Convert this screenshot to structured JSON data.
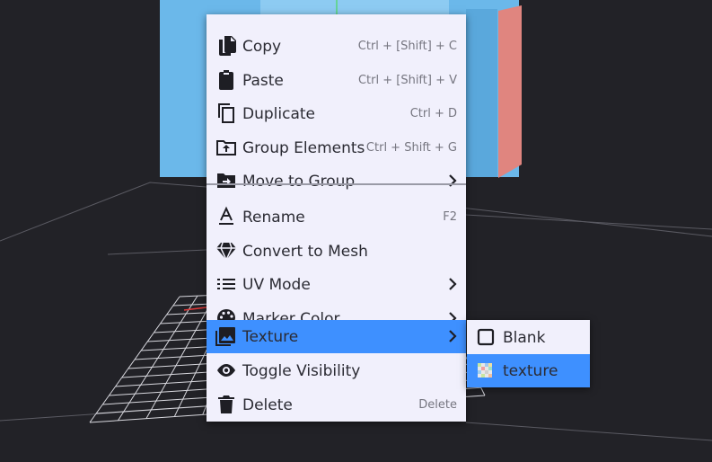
{
  "colors": {
    "viewport_bg": "#222227",
    "menu_bg": "#f1f0fc",
    "highlight": "#3e90ff",
    "text": "#2b2b33",
    "shortcut": "#767680",
    "cube_blue": "#6bb8ea",
    "cube_red": "#e0857f"
  },
  "context_menu": {
    "items": [
      {
        "label": "Copy",
        "shortcut": "Ctrl + [Shift] + C",
        "icon": "copy-icon"
      },
      {
        "label": "Paste",
        "shortcut": "Ctrl + [Shift] + V",
        "icon": "paste-icon"
      },
      {
        "label": "Duplicate",
        "shortcut": "Ctrl + D",
        "icon": "duplicate-icon"
      },
      {
        "label": "Group Elements",
        "shortcut": "Ctrl + Shift + G",
        "icon": "group-elements-icon"
      },
      {
        "label": "Move to Group",
        "icon": "move-to-group-icon",
        "submenu": true
      },
      {
        "label": "Rename",
        "shortcut": "F2",
        "icon": "rename-icon"
      },
      {
        "label": "Convert to Mesh",
        "icon": "gem-icon"
      },
      {
        "label": "UV Mode",
        "icon": "list-icon",
        "submenu": true
      },
      {
        "label": "Marker Color",
        "icon": "palette-icon",
        "submenu": true
      },
      {
        "label": "Texture",
        "icon": "image-icon",
        "submenu": true,
        "highlighted": true
      },
      {
        "label": "Toggle Visibility",
        "icon": "eye-icon"
      },
      {
        "label": "Delete",
        "shortcut": "Delete",
        "icon": "trash-icon"
      }
    ]
  },
  "texture_submenu": {
    "items": [
      {
        "label": "Blank",
        "icon": "blank-square-icon"
      },
      {
        "label": "texture",
        "icon": "texture-thumbnail-icon",
        "highlighted": true
      }
    ]
  }
}
